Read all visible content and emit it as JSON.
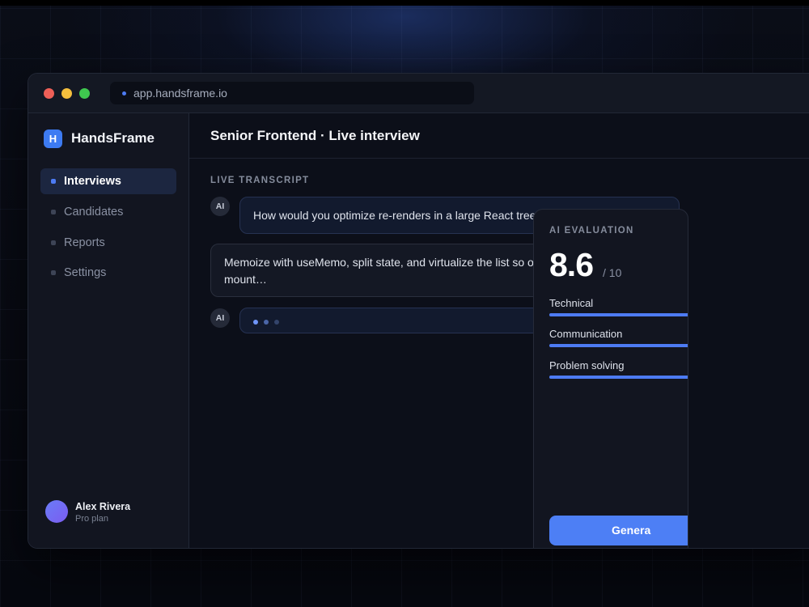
{
  "browser": {
    "url": "app.handsframe.io"
  },
  "sidebar": {
    "brand": {
      "logo_letter": "H",
      "name": "HandsFrame"
    },
    "items": [
      {
        "label": "Interviews",
        "active": true
      },
      {
        "label": "Candidates",
        "active": false
      },
      {
        "label": "Reports",
        "active": false
      },
      {
        "label": "Settings",
        "active": false
      }
    ],
    "user": {
      "name": "Alex Rivera",
      "plan": "Pro plan"
    }
  },
  "main": {
    "title": "Senior Frontend · Live interview",
    "transcript_label": "LIVE TRANSCRIPT",
    "messages": [
      {
        "role": "ai",
        "avatar_label": "AI",
        "text": "How would you optimize re-renders in a large React tree?"
      },
      {
        "role": "candidate",
        "text": "Memoize with useMemo, split state, and virtualize the list so only visible rows mount…"
      },
      {
        "role": "ai",
        "avatar_label": "AI",
        "typing": true
      }
    ]
  },
  "evaluation": {
    "label": "AI EVALUATION",
    "score": "8.6",
    "score_max": "/ 10",
    "metrics": [
      {
        "label": "Technical"
      },
      {
        "label": "Communication"
      },
      {
        "label": "Problem solving"
      }
    ],
    "action_label": "Genera"
  },
  "colors": {
    "accent": "#4d7bf3",
    "background": "#0c0f19",
    "sidebar": "#121520",
    "traffic_red": "#ee5f57",
    "traffic_yellow": "#f4be3d",
    "traffic_green": "#3fc84f"
  }
}
